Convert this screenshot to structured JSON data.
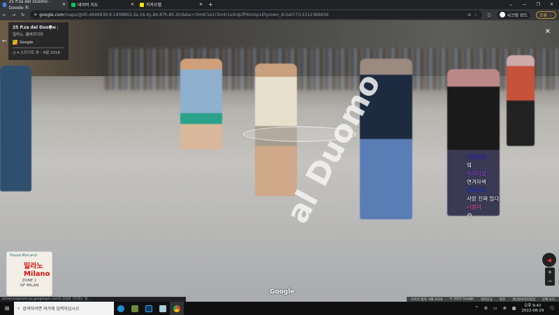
{
  "browser": {
    "tabs": [
      {
        "title": "25 P.za del Duomo - Google 지",
        "favicon": "#4285f4",
        "active": true
      },
      {
        "title": "네이버 지도",
        "favicon": "#03c75a",
        "active": false
      },
      {
        "title": "카카오맵",
        "favicon": "#fee500",
        "active": false
      }
    ],
    "url_domain": "google.com",
    "url_path": "/maps/@45.4646939,9.1908863,3a,16.4y,84.87h,80.2t/data=!3m6!1e1!3m4!1sXrqUfFKmiqcLEtyrown_A!2e0!7i13312!8i6656",
    "profile": "시크릿 모드",
    "error_label": "오류"
  },
  "place": {
    "title": "25 P.za del Duomo",
    "subtitle": "밀라노, 롬바르디아",
    "source": "Google",
    "date": "스트리트 뷰 - 9월 2018"
  },
  "street_label": "al Duomo",
  "chat": [
    {
      "name": "오징오징",
      "msg": "엌",
      "color": "#3b3bff"
    },
    {
      "name": "미라리엘",
      "msg": "연겨자색",
      "color": "#a24cf0"
    },
    {
      "name": "개미고원",
      "msg": "사람 진짜 많다",
      "color": "#2a4bff"
    },
    {
      "name": "나림미",
      "msg": "😷",
      "color": "#ff5ea8"
    }
  ],
  "minimap": {
    "place": "Piazza Mercanti",
    "city_ko": "밀라노",
    "city_en": "Milano",
    "zone": "ZONE 1",
    "zone2": "OF MILAN"
  },
  "google_logo": "Google",
  "footer": [
    "이미지 캡처: 9월 2018",
    "© 2022 Google",
    "대한민국",
    "약관",
    "개인정보처리방침",
    "문제 보고"
  ],
  "status_text": "streetviewpixels-pa.googleapis.com의 응답을 기다리는 중...",
  "taskbar": {
    "search_placeholder": "검색하려면 여기에 입력하십시오",
    "time": "오후 9:42",
    "date": "2022-08-29"
  }
}
